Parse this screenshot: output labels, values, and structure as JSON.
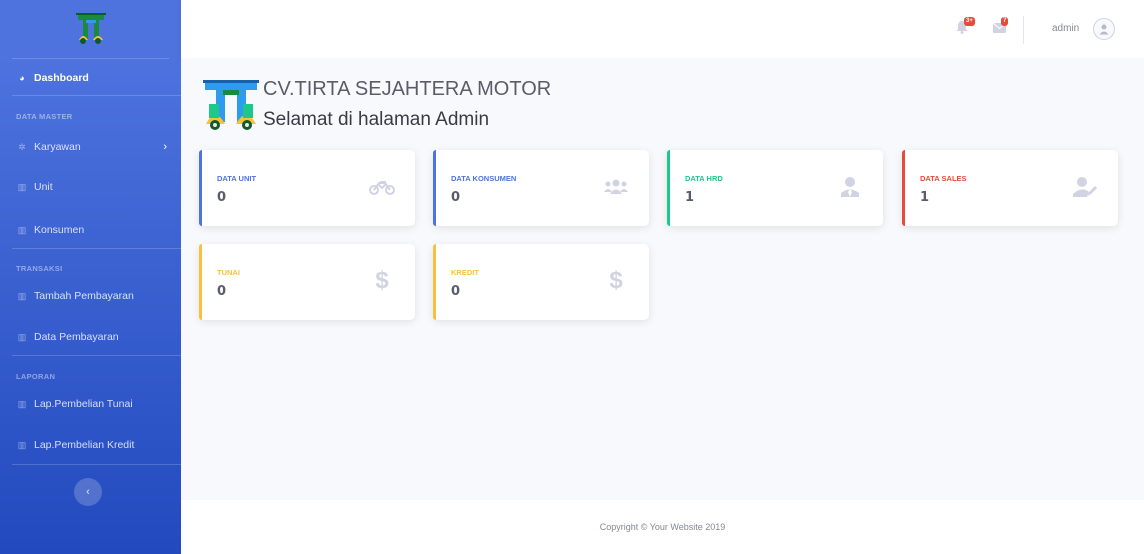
{
  "sidebar": {
    "brand_icon": "tsm-logo-icon",
    "dashboard": "Dashboard",
    "heading_master": "DATA MASTER",
    "karyawan": "Karyawan",
    "unit": "Unit",
    "konsumen": "Konsumen",
    "heading_transaksi": "TRANSAKSI",
    "tambah_pembayaran": "Tambah Pembayaran",
    "data_pembayaran": "Data Pembayaran",
    "heading_laporan": "LAPORAN",
    "lap_tunai": "Lap.Pembelian Tunai",
    "lap_kredit": "Lap.Pembelian Kredit",
    "toggle_glyph": "‹"
  },
  "topbar": {
    "alerts_badge": "3+",
    "messages_badge": "7",
    "user_name": "admin"
  },
  "main": {
    "company": "CV.TIRTA SEJAHTERA MOTOR",
    "welcome": "Selamat di halaman Admin"
  },
  "cards": [
    {
      "label": "DATA UNIT",
      "value": "0",
      "color": "#4e73df",
      "icon": "motorcycle-icon"
    },
    {
      "label": "DATA KONSUMEN",
      "value": "0",
      "color": "#4e73df",
      "icon": "users-icon"
    },
    {
      "label": "DATA HRD",
      "value": "1",
      "color": "#1cc88a",
      "icon": "user-tie-icon"
    },
    {
      "label": "DATA SALES",
      "value": "1",
      "color": "#e74a3b",
      "icon": "user-edit-icon"
    },
    {
      "label": "TUNAI",
      "value": "0",
      "color": "#f6c23e",
      "icon": "dollar-icon"
    },
    {
      "label": "KREDIT",
      "value": "0",
      "color": "#f6c23e",
      "icon": "dollar-icon"
    }
  ],
  "footer": {
    "copyright": "Copyright © Your Website 2019"
  }
}
